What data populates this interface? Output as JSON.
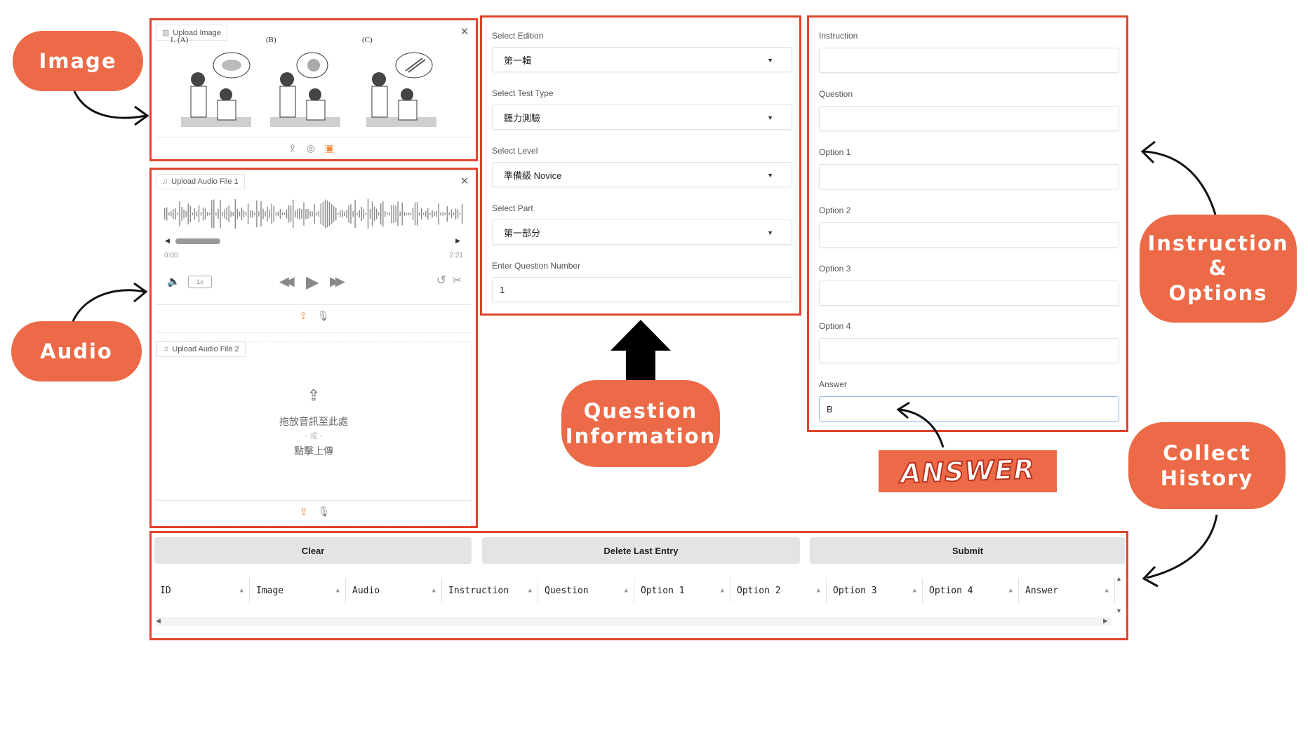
{
  "callouts": {
    "image": "Image",
    "audio": "Audio",
    "question_info_1": "Question",
    "question_info_2": "Information",
    "instr_1": "Instruction",
    "instr_2": "&",
    "instr_3": "Options",
    "history_1": "Collect",
    "history_2": "History",
    "answer_banner": "ANSWER"
  },
  "image_panel": {
    "label": "Upload Image",
    "option_labels": [
      "1.  (A)",
      "(B)",
      "(C)"
    ]
  },
  "audio1": {
    "label": "Upload Audio File 1",
    "time_start": "0:00",
    "time_end": "2:21",
    "speed": "1x"
  },
  "audio2": {
    "label": "Upload Audio File 2",
    "drop_text": "拖放音訊至此處",
    "or_text": "- 或 -",
    "click_text": "點擊上傳"
  },
  "question_info": {
    "edition_label": "Select Edition",
    "edition_value": "第一輯",
    "test_type_label": "Select Test Type",
    "test_type_value": "聽力測驗",
    "level_label": "Select Level",
    "level_value": "準備級 Novice",
    "part_label": "Select Part",
    "part_value": "第一部分",
    "qnum_label": "Enter Question Number",
    "qnum_value": "1"
  },
  "instruction_options": {
    "instruction_label": "Instruction",
    "question_label": "Question",
    "option1_label": "Option 1",
    "option2_label": "Option 2",
    "option3_label": "Option 3",
    "option4_label": "Option 4",
    "answer_label": "Answer",
    "answer_value": "B"
  },
  "history": {
    "clear_label": "Clear",
    "delete_label": "Delete Last Entry",
    "submit_label": "Submit",
    "columns": [
      "ID",
      "Image",
      "Audio",
      "Instruction",
      "Question",
      "Option 1",
      "Option 2",
      "Option 3",
      "Option 4",
      "Answer"
    ]
  },
  "colors": {
    "accent": "#ec6a47",
    "border_red": "#e0442d"
  }
}
